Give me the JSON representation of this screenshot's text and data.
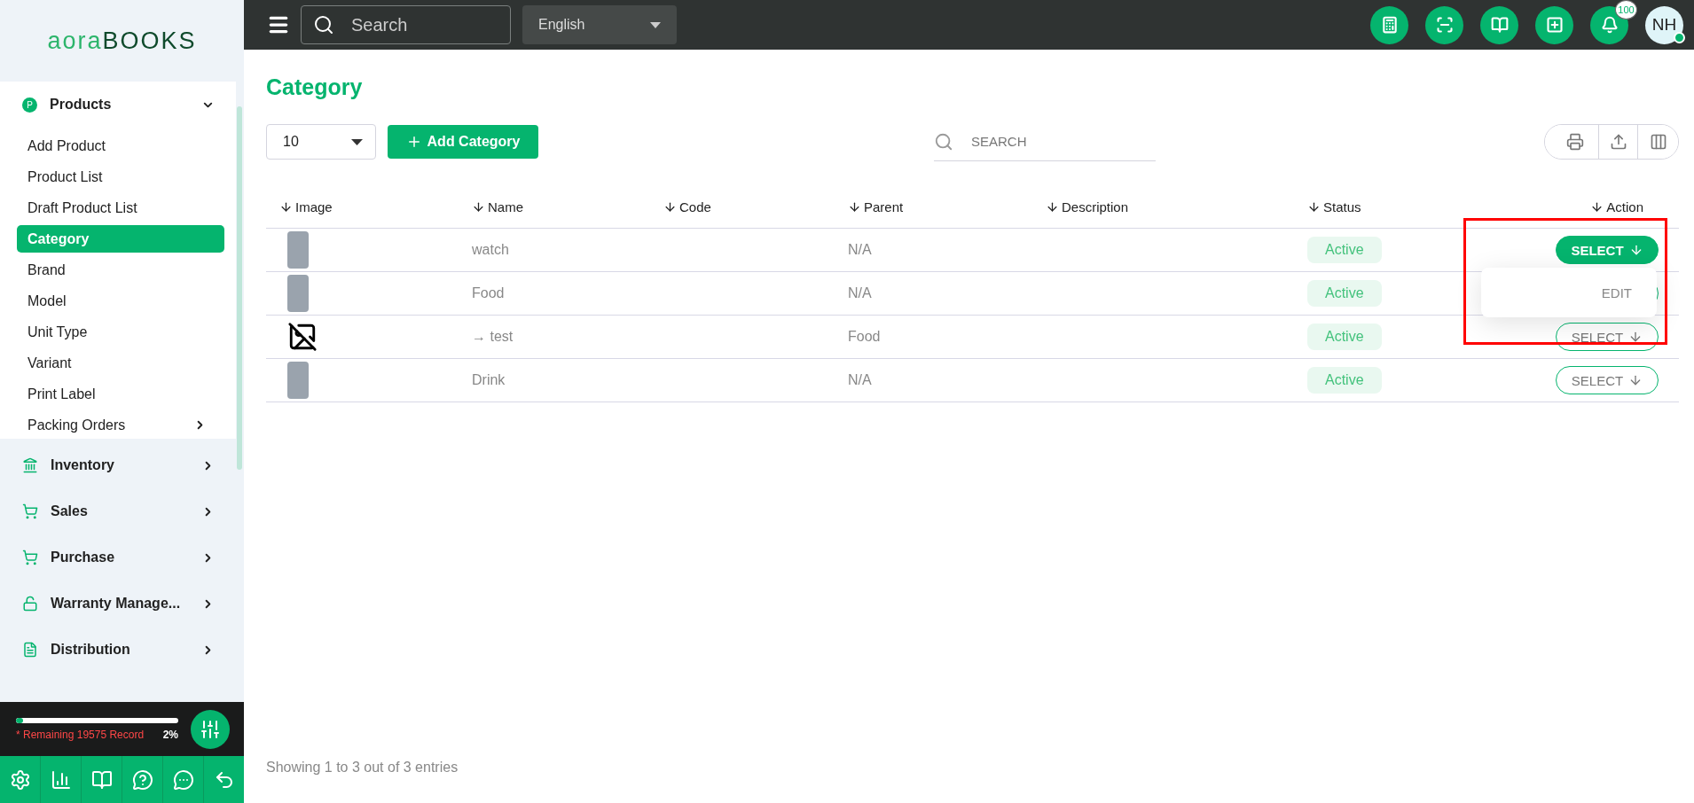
{
  "logo": "aora**BOOKS**",
  "topbar": {
    "search": {
      "placeholder": "Search"
    },
    "language": "English",
    "actions": [
      {
        "kind": "calculator"
      },
      {
        "kind": "scan"
      },
      {
        "kind": "book"
      },
      {
        "kind": "add"
      },
      {
        "kind": "bell",
        "badge": "100"
      }
    ],
    "avatar": {
      "initials": "NH",
      "online": true
    }
  },
  "sidebar": {
    "items": [
      {
        "label": "Products",
        "kind": "letter",
        "icon_letter": "P",
        "expanded": true,
        "children": [
          {
            "label": "Add Product",
            "selected": false,
            "submenu": false
          },
          {
            "label": "Product List",
            "selected": false,
            "submenu": false
          },
          {
            "label": "Draft Product List",
            "selected": false,
            "submenu": false
          },
          {
            "label": "Category",
            "selected": true,
            "submenu": false
          },
          {
            "label": "Brand",
            "selected": false,
            "submenu": false
          },
          {
            "label": "Model",
            "selected": false,
            "submenu": false
          },
          {
            "label": "Unit Type",
            "selected": false,
            "submenu": false
          },
          {
            "label": "Variant",
            "selected": false,
            "submenu": false
          },
          {
            "label": "Print Label",
            "selected": false,
            "submenu": false
          },
          {
            "label": "Packing Orders",
            "selected": false,
            "submenu": true
          }
        ]
      },
      {
        "label": "Inventory",
        "kind": "bank",
        "expanded": false
      },
      {
        "label": "Sales",
        "kind": "cart",
        "expanded": false
      },
      {
        "label": "Purchase",
        "kind": "cart",
        "expanded": false
      },
      {
        "label": "Warranty Manage...",
        "kind": "lock",
        "expanded": false
      },
      {
        "label": "Distribution",
        "kind": "document",
        "expanded": false
      }
    ],
    "usage": {
      "level": 0.02,
      "text": "* Remaining 19575 Record",
      "percent": "2%"
    },
    "bottom_icons": [
      {
        "kind": "settings"
      },
      {
        "kind": "chart"
      },
      {
        "kind": "book"
      },
      {
        "kind": "help"
      },
      {
        "kind": "chat"
      },
      {
        "kind": "back"
      }
    ]
  },
  "page": {
    "title": "Category",
    "page_size": "10",
    "add_button": "Add Category",
    "search": {
      "placeholder": "SEARCH"
    },
    "tools": [
      {
        "kind": "print"
      },
      {
        "kind": "export"
      },
      {
        "kind": "columns"
      }
    ]
  },
  "table": {
    "columns": [
      "Image",
      "Name",
      "Code",
      "Parent",
      "Description",
      "Status",
      "Action"
    ],
    "rows": [
      {
        "kind": "photo",
        "name": "watch",
        "parent": "N/A",
        "status": "Active",
        "action": "SELECT",
        "menu_open": true,
        "annotated": true
      },
      {
        "kind": "photo",
        "name": "Food",
        "parent": "N/A",
        "status": "Active",
        "action": "",
        "menu_open": false,
        "annotated": false
      },
      {
        "kind": "none",
        "name": "→ test",
        "parent": "Food",
        "status": "Active",
        "action": "SELECT",
        "menu_open": false,
        "annotated": false
      },
      {
        "kind": "photo",
        "name": "Drink",
        "parent": "N/A",
        "status": "Active",
        "action": "SELECT",
        "menu_open": false,
        "annotated": false
      }
    ],
    "menu": [
      "EDIT"
    ]
  },
  "footer": "Showing 1 to 3 out of 3 entries"
}
